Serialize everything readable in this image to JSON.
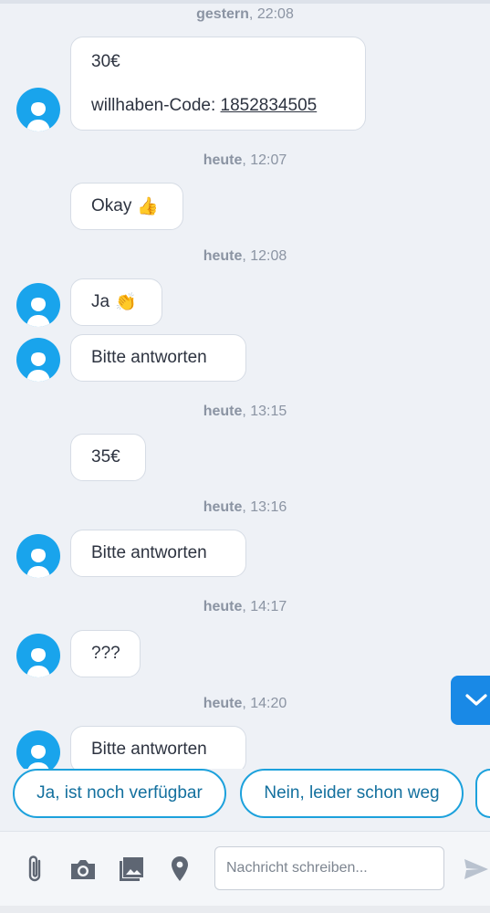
{
  "timestamps": [
    {
      "day": "gestern",
      "time": "22:08"
    },
    {
      "day": "heute",
      "time": "12:07"
    },
    {
      "day": "heute",
      "time": "12:08"
    },
    {
      "day": "heute",
      "time": "13:15"
    },
    {
      "day": "heute",
      "time": "13:16"
    },
    {
      "day": "heute",
      "time": "14:17"
    },
    {
      "day": "heute",
      "time": "14:20"
    }
  ],
  "messages": [
    {
      "line1": "30€",
      "code_label": "willhaben-Code: ",
      "code": "1852834505",
      "sender": "other"
    },
    {
      "text": "Okay",
      "emoji": "👍",
      "sender": "me"
    },
    {
      "text": "Ja",
      "emoji": "👏",
      "sender": "other"
    },
    {
      "text": "Bitte antworten",
      "sender": "other"
    },
    {
      "text": "35€",
      "sender": "me"
    },
    {
      "text": "Bitte antworten",
      "sender": "other"
    },
    {
      "text": "???",
      "sender": "other"
    },
    {
      "text": "Bitte antworten",
      "sender": "other"
    }
  ],
  "quick_replies": [
    "Ja, ist noch verfügbar",
    "Nein, leider schon weg",
    ""
  ],
  "composer": {
    "placeholder": "Nachricht schreiben...",
    "icons": [
      "paperclip-icon",
      "camera-icon",
      "image-icon",
      "location-pin-icon",
      "send-icon"
    ]
  },
  "colors": {
    "background": "#eef1f6",
    "avatar": "#19a4ec",
    "accent": "#1989e6",
    "quick_reply_border": "#1ca1dc"
  }
}
